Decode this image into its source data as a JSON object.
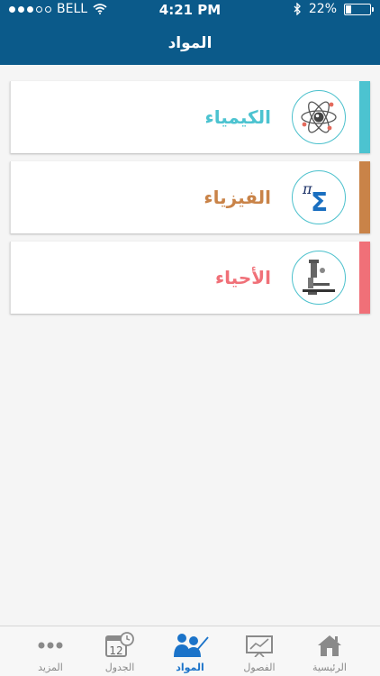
{
  "status_bar": {
    "carrier": "BELL",
    "time": "4:21 PM",
    "battery_percent": "22%",
    "battery_level": 0.22
  },
  "header": {
    "title": "المواد"
  },
  "subjects": [
    {
      "label": "الكيمياء",
      "color": "#4cc3d0",
      "icon": "atom-icon"
    },
    {
      "label": "الفيزياء",
      "color": "#c98348",
      "icon": "pi-sigma-icon"
    },
    {
      "label": "الأحياء",
      "color": "#f07078",
      "icon": "microscope-icon"
    }
  ],
  "tabs": [
    {
      "label": "الرئيسية",
      "icon": "home-icon",
      "active": false
    },
    {
      "label": "الفصول",
      "icon": "chart-board-icon",
      "active": false
    },
    {
      "label": "المواد",
      "icon": "teacher-icon",
      "active": true
    },
    {
      "label": "الجدول",
      "icon": "calendar-clock-icon",
      "active": false,
      "badge": "12"
    },
    {
      "label": "المزيد",
      "icon": "more-dots-icon",
      "active": false
    }
  ],
  "colors": {
    "header_bg": "#0b5a8a",
    "tab_active": "#1b73c9",
    "tab_inactive": "#8a8a8a"
  }
}
